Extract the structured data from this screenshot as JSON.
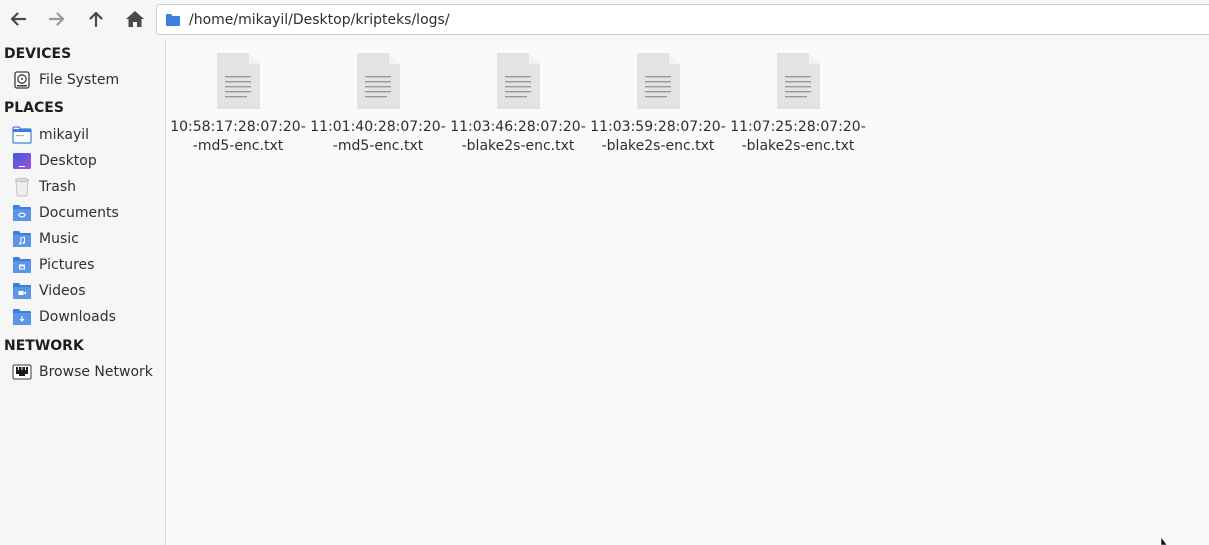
{
  "toolbar": {
    "back_icon": "arrow-left-icon",
    "forward_icon": "arrow-right-icon",
    "up_icon": "arrow-up-icon",
    "home_icon": "home-icon",
    "path": "/home/mikayil/Desktop/kripteks/logs/"
  },
  "sidebar": {
    "devices_header": "DEVICES",
    "devices": [
      {
        "label": "File System",
        "icon": "harddisk-icon"
      }
    ],
    "places_header": "PLACES",
    "places": [
      {
        "label": "mikayil",
        "icon": "home-folder-icon"
      },
      {
        "label": "Desktop",
        "icon": "desktop-icon"
      },
      {
        "label": "Trash",
        "icon": "trash-icon"
      },
      {
        "label": "Documents",
        "icon": "documents-folder-icon"
      },
      {
        "label": "Music",
        "icon": "music-folder-icon"
      },
      {
        "label": "Pictures",
        "icon": "pictures-folder-icon"
      },
      {
        "label": "Videos",
        "icon": "videos-folder-icon"
      },
      {
        "label": "Downloads",
        "icon": "downloads-folder-icon"
      }
    ],
    "network_header": "NETWORK",
    "network": [
      {
        "label": "Browse Network",
        "icon": "network-icon"
      }
    ]
  },
  "files": [
    {
      "line1": "10:58:17:28:07:20-",
      "line2": "-md5-enc.txt"
    },
    {
      "line1": "11:01:40:28:07:20-",
      "line2": "-md5-enc.txt"
    },
    {
      "line1": "11:03:46:28:07:20-",
      "line2": "-blake2s-enc.txt"
    },
    {
      "line1": "11:03:59:28:07:20-",
      "line2": "-blake2s-enc.txt"
    },
    {
      "line1": "11:07:25:28:07:20-",
      "line2": "-blake2s-enc.txt"
    }
  ],
  "colors": {
    "folder_blue": "#3d7fe0",
    "doc_gray": "#e2e2e2",
    "doc_lines": "#9a9a9a"
  }
}
